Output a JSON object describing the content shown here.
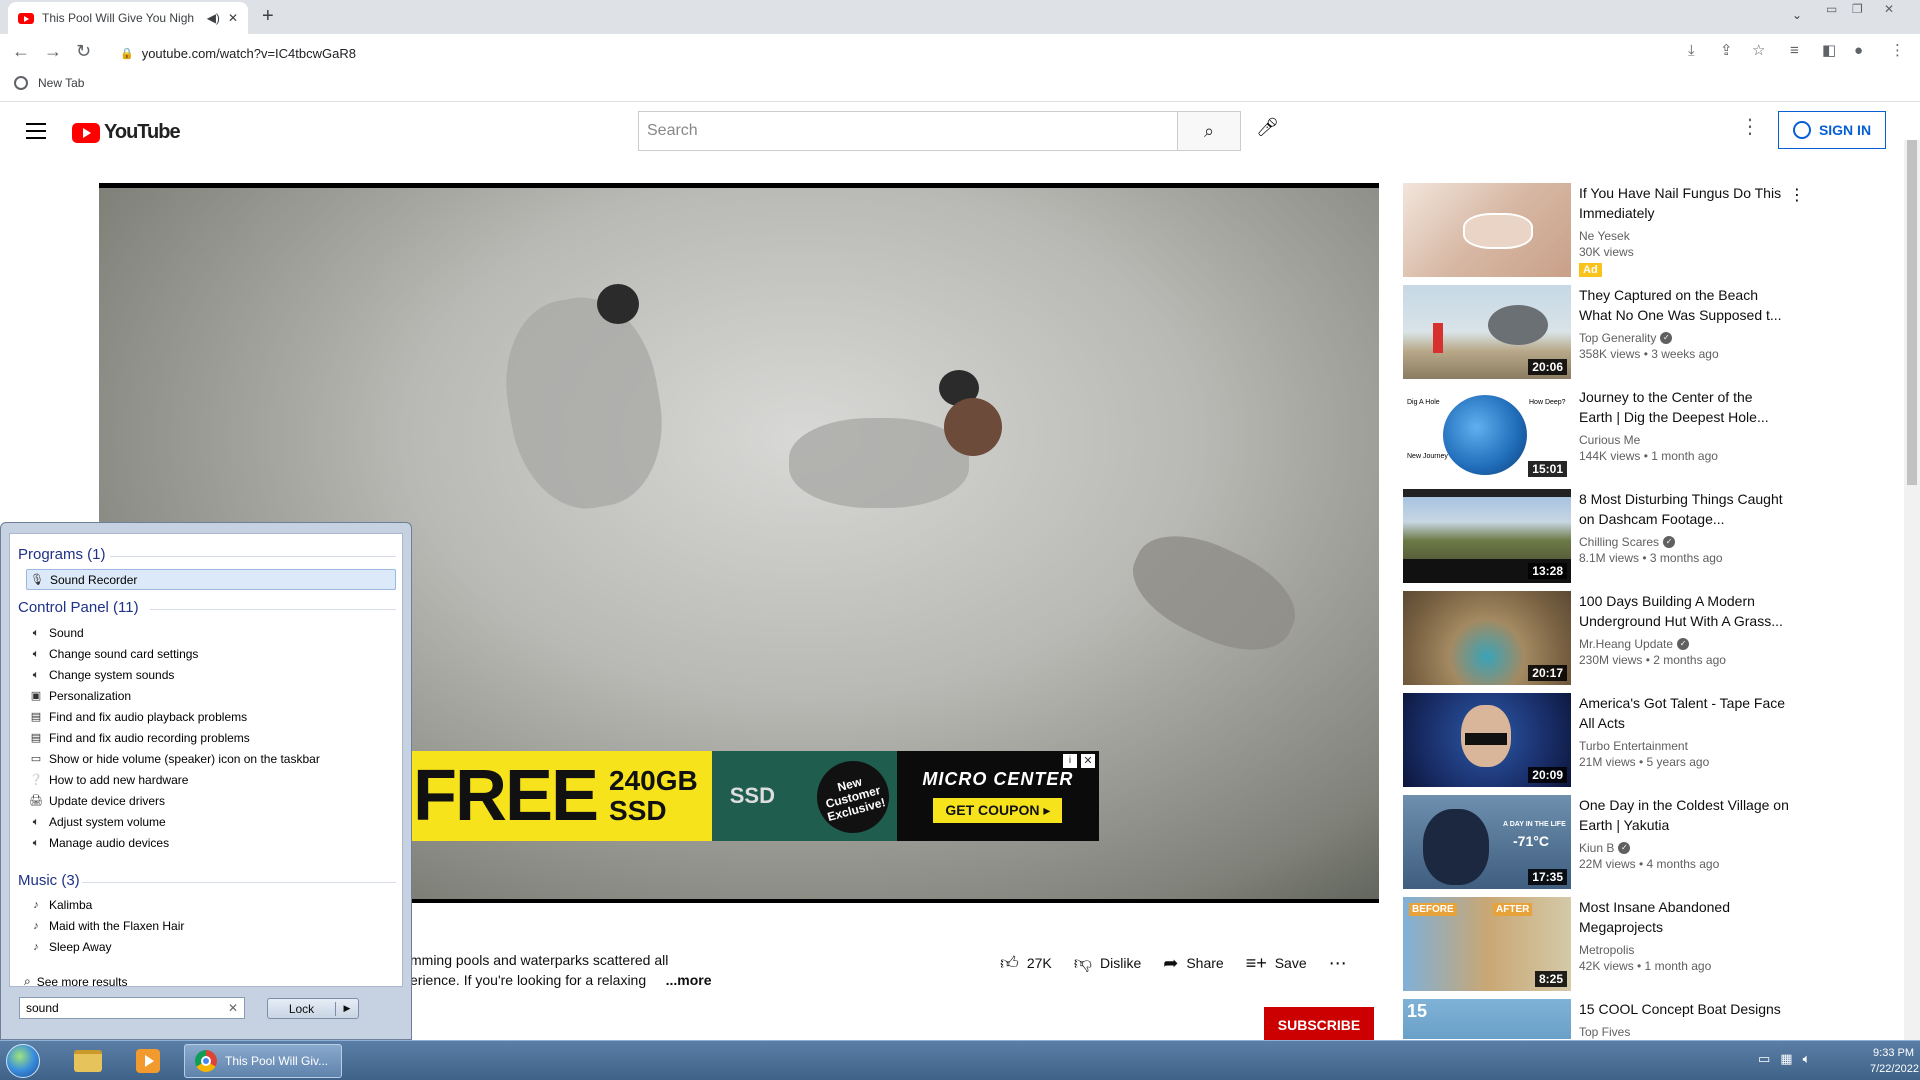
{
  "browser": {
    "tab_title": "This Pool Will Give You Nigh",
    "tab_audio_icon": "speaker-icon",
    "new_tab_symbol": "+",
    "url": "youtube.com/watch?v=IC4tbcwGaR8",
    "bookmark_label": "New Tab"
  },
  "youtube": {
    "logo_text": "YouTube",
    "search_placeholder": "Search",
    "sign_in_label": "SIGN IN"
  },
  "ad": {
    "free_text": "FREE",
    "size_text_1": "240GB",
    "size_text_2": "SSD",
    "ssd_label": "SSD",
    "starburst_text": "New Customer Exclusive!",
    "brand": "MICRO CENTER",
    "coupon": "GET COUPON ▸"
  },
  "video_meta": {
    "desc_line_1": "mming pools and waterparks scattered all",
    "desc_line_2": "erience. If you're looking for a relaxing",
    "more_label": "...more",
    "likes": "27K",
    "dislike_label": "Dislike",
    "share_label": "Share",
    "save_label": "Save",
    "subscribe_label": "SUBSCRIBE"
  },
  "recommendations": [
    {
      "title": "If You Have Nail Fungus Do This Immediately",
      "channel": "Ne Yesek",
      "meta": "30K views",
      "ad": "Ad",
      "duration": "",
      "verified": false
    },
    {
      "title": "They Captured on the Beach What No One Was Supposed t...",
      "channel": "Top Generality",
      "meta": "358K views • 3 weeks ago",
      "duration": "20:06",
      "verified": true
    },
    {
      "title": "Journey to the Center of the Earth | Dig the Deepest Hole...",
      "channel": "Curious Me",
      "meta": "144K views • 1 month ago",
      "duration": "15:01",
      "verified": false
    },
    {
      "title": "8 Most Disturbing Things Caught on Dashcam Footage...",
      "channel": "Chilling Scares",
      "meta": "8.1M views • 3 months ago",
      "duration": "13:28",
      "verified": true
    },
    {
      "title": "100 Days Building A Modern Underground Hut With A Grass...",
      "channel": "Mr.Heang Update",
      "meta": "230M views • 2 months ago",
      "duration": "20:17",
      "verified": true
    },
    {
      "title": "America's Got Talent - Tape Face All Acts",
      "channel": "Turbo Entertainment",
      "meta": "21M views • 5 years ago",
      "duration": "20:09",
      "verified": false
    },
    {
      "title": "One Day in the Coldest Village on Earth | Yakutia",
      "channel": "Kiun B",
      "meta": "22M views • 4 months ago",
      "duration": "17:35",
      "verified": true
    },
    {
      "title": "Most Insane Abandoned Megaprojects",
      "channel": "Metropolis",
      "meta": "42K views • 1 month ago",
      "duration": "8:25",
      "verified": false
    },
    {
      "title": "15 COOL Concept Boat Designs",
      "channel": "Top Fives",
      "meta": "",
      "duration": "",
      "verified": false
    }
  ],
  "thumb_texts": {
    "dig_a_hole": "Dig A Hole",
    "how_deep": "How Deep?",
    "new_journey": "New Journey",
    "yakutia_badge": "A DAY IN THE LIFE",
    "temperature": "-71°C",
    "before": "BEFORE",
    "after": "AFTER",
    "boat_number": "15"
  },
  "start_menu": {
    "programs_heading": "Programs (1)",
    "programs": [
      "Sound Recorder"
    ],
    "control_panel_heading": "Control Panel (11)",
    "control_panel": [
      "Sound",
      "Change sound card settings",
      "Change system sounds",
      "Personalization",
      "Find and fix audio playback problems",
      "Find and fix audio recording problems",
      "Show or hide volume (speaker) icon on the taskbar",
      "How to add new hardware",
      "Update device drivers",
      "Adjust system volume",
      "Manage audio devices"
    ],
    "music_heading": "Music (3)",
    "music": [
      "Kalimba",
      "Maid with the Flaxen Hair",
      "Sleep Away"
    ],
    "see_more": "See more results",
    "search_value": "sound",
    "lock_label": "Lock"
  },
  "taskbar": {
    "chrome_label": "This Pool Will Giv...",
    "time": "9:33 PM",
    "date": "7/22/2022"
  },
  "colors": {
    "youtube_red": "#ff0000",
    "link_blue": "#065fd4",
    "subscribe_red": "#cc0000",
    "ad_yellow": "#f7e31b"
  }
}
